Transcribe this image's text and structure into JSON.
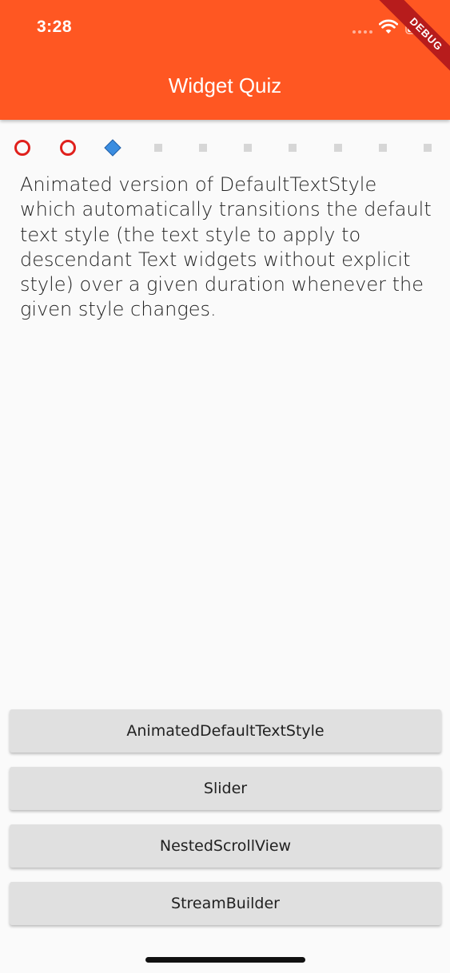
{
  "status_bar": {
    "time": "3:28"
  },
  "app_bar": {
    "title": "Widget Quiz",
    "color": "#ff5722"
  },
  "debug_banner": {
    "label": "DEBUG"
  },
  "progress": {
    "marks": [
      "wrong",
      "wrong",
      "current",
      "pending",
      "pending",
      "pending",
      "pending",
      "pending",
      "pending",
      "pending"
    ],
    "colors": {
      "wrong": "#e0201c",
      "current": "#3b8de0",
      "pending": "#d6d6d6"
    }
  },
  "question": {
    "text": "Animated version of DefaultTextStyle which automatically transitions the default text style (the text style to apply to descendant Text widgets without explicit style) over a given duration whenever the given style changes."
  },
  "answers": [
    {
      "label": "AnimatedDefaultTextStyle"
    },
    {
      "label": "Slider"
    },
    {
      "label": "NestedScrollView"
    },
    {
      "label": "StreamBuilder"
    }
  ]
}
